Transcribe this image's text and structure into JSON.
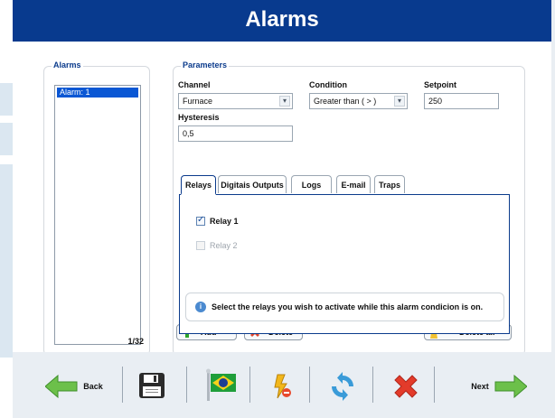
{
  "header": {
    "title": "Alarms"
  },
  "alarms_panel": {
    "legend": "Alarms",
    "items": [
      {
        "label": "Alarm: 1",
        "selected": true
      }
    ],
    "count": "1/32"
  },
  "parameters": {
    "legend": "Parameters",
    "channel": {
      "label": "Channel",
      "value": "Furnace"
    },
    "condition": {
      "label": "Condition",
      "value": "Greater than ( > )"
    },
    "setpoint": {
      "label": "Setpoint",
      "value": "250"
    },
    "hysteresis": {
      "label": "Hysteresis",
      "value": "0,5"
    }
  },
  "tabs": [
    {
      "label": "Relays",
      "active": true
    },
    {
      "label": "Digitais Outputs",
      "active": false
    },
    {
      "label": "Logs",
      "active": false
    },
    {
      "label": "E-mail",
      "active": false
    },
    {
      "label": "Traps",
      "active": false
    }
  ],
  "relays": [
    {
      "label": "Relay 1",
      "checked": true,
      "enabled": true
    },
    {
      "label": "Relay 2",
      "checked": false,
      "enabled": false
    }
  ],
  "info": {
    "text": "Select the relays you wish to activate while this alarm condicion is on."
  },
  "actions": {
    "add_label": "Add",
    "delete_label": "Delete",
    "delete_all_label": "Delete all"
  },
  "footer": {
    "back_label": "Back",
    "next_label": "Next",
    "icons": [
      "back-arrow-icon",
      "save-icon",
      "brazil-flag-icon",
      "flash-icon",
      "refresh-icon",
      "close-icon",
      "next-arrow-icon"
    ]
  },
  "colors": {
    "header_bg": "#083a8e",
    "accent_blue": "#0b3b8c",
    "selection_blue": "#0a57d4",
    "footer_bg": "#e9eef3"
  }
}
